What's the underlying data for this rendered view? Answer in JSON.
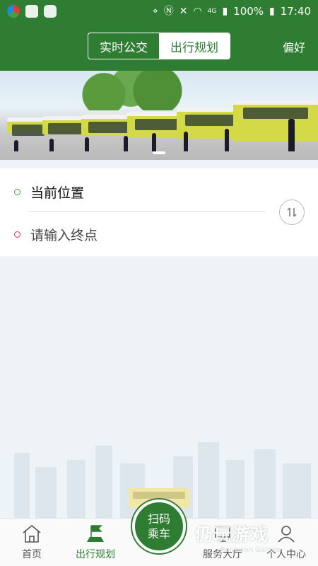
{
  "status_bar": {
    "battery": "100%",
    "time": "17:40",
    "network": "4G"
  },
  "header": {
    "tabs": [
      {
        "label": "实时公交",
        "active": false
      },
      {
        "label": "出行规划",
        "active": true
      }
    ],
    "preferences": "偏好"
  },
  "route": {
    "origin": "当前位置",
    "destination_placeholder": "请输入终点",
    "swap_icon": "swap-arrows-icon"
  },
  "bottom_nav": {
    "home": "首页",
    "trip_planning": "出行规划",
    "scan_line1": "扫码",
    "scan_line2": "乘车",
    "service_hall": "服务大厅",
    "profile": "个人中心"
  },
  "watermark": {
    "title": "仍玩游戏",
    "sub": "Rengwan Games"
  },
  "colors": {
    "primary": "#2e7d32",
    "origin_dot": "#43a047",
    "destination_dot": "#e53935"
  }
}
